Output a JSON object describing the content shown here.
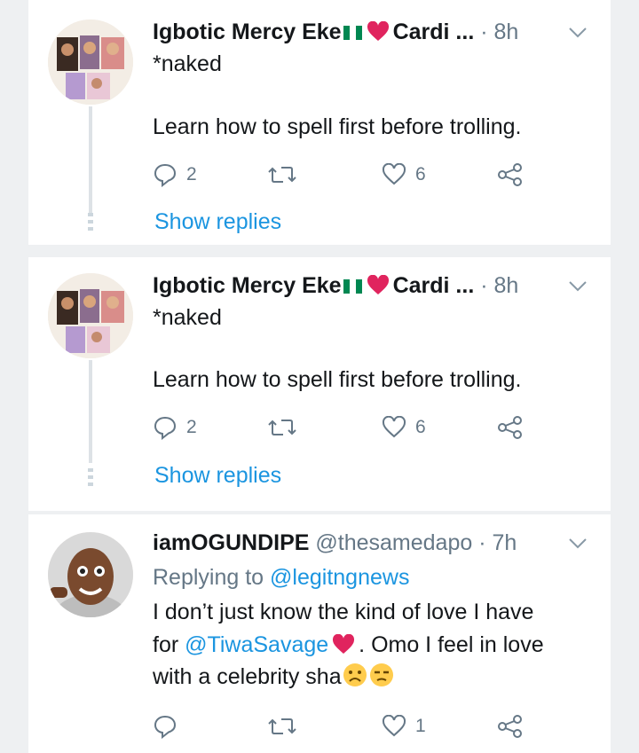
{
  "tweets": [
    {
      "author_name": "Igbotic Mercy Eke",
      "author_suffix": "Cardi ...",
      "time": "· 8h",
      "lines": [
        "*naked",
        "Learn how to spell first before trolling."
      ],
      "reply_count": "2",
      "like_count": "6",
      "show_replies": "Show replies"
    },
    {
      "author_name": "Igbotic Mercy Eke",
      "author_suffix": "Cardi ...",
      "time": "· 8h",
      "lines": [
        "*naked",
        "Learn how to spell first before trolling."
      ],
      "reply_count": "2",
      "like_count": "6",
      "show_replies": "Show replies"
    },
    {
      "author_name": "iamOGUNDIPE",
      "handle": "@thesamedapo",
      "time": "· 7h",
      "replying_prefix": "Replying to",
      "replying_to": "@legitngnews",
      "line1": "I don’t just know the kind of love I have",
      "line2_prefix": "for",
      "mention": "@TiwaSavage",
      "line2_suffix": ". Omo I feel in love",
      "line3": "with a celebrity sha",
      "like_count": "1"
    }
  ],
  "icons": {
    "reply": "reply-icon",
    "retweet": "retweet-icon",
    "like": "like-icon",
    "share": "share-icon",
    "caret": "chevron-down-icon"
  },
  "colors": {
    "link": "#1b95e0",
    "muted": "#657786",
    "heart": "#e0245e",
    "nigeria_green": "#008751"
  }
}
